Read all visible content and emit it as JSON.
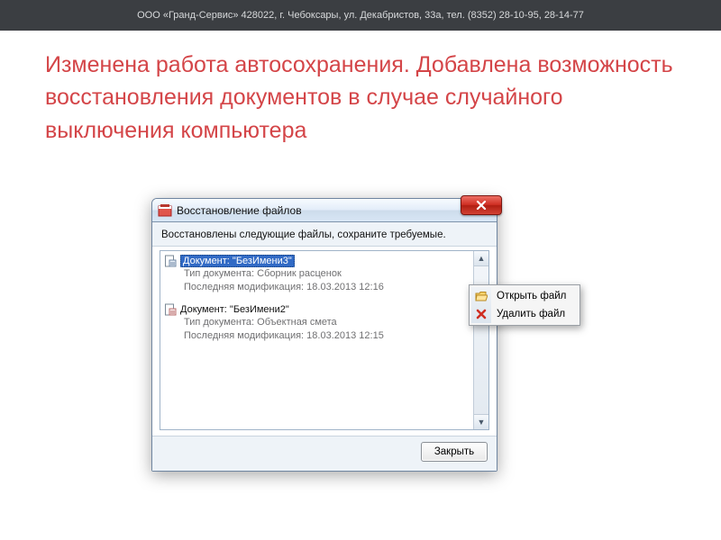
{
  "header": {
    "company_line": "ООО «Гранд-Сервис» 428022, г. Чебоксары, ул. Декабристов, 33а, тел. (8352) 28-10-95, 28-14-77"
  },
  "headline": "Изменена работа автосохранения. Добавлена возможность восстановления документов в  случае случайного выключения компьютера",
  "dialog": {
    "title": "Восстановление файлов",
    "instruction": "Восстановлены следующие файлы, сохраните требуемые.",
    "close_button": "Закрыть",
    "entries": [
      {
        "name": "Документ: \"БезИмени3\"",
        "type_label": "Тип документа:",
        "type_value": "Сборник расценок",
        "mod_label": "Последняя модификация:",
        "mod_value": "18.03.2013 12:16",
        "selected": true
      },
      {
        "name": "Документ: \"БезИмени2\"",
        "type_label": "Тип документа:",
        "type_value": "Объектная смета",
        "mod_label": "Последняя модификация:",
        "mod_value": "18.03.2013 12:15",
        "selected": false
      }
    ]
  },
  "context_menu": {
    "open": "Открыть файл",
    "delete": "Удалить файл"
  }
}
